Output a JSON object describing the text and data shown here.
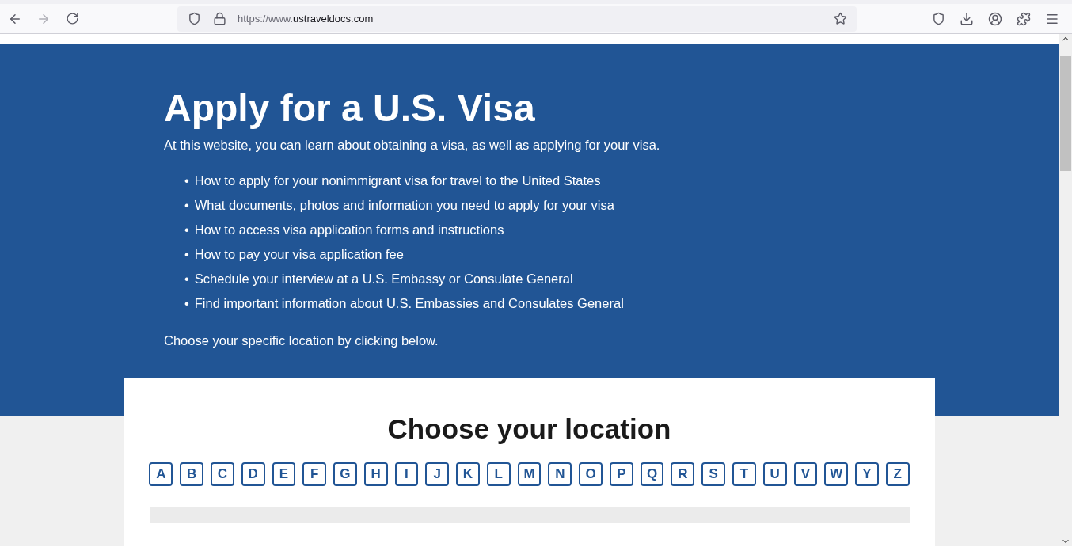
{
  "browser": {
    "url_prefix": "https://www.",
    "url_domain": "ustraveldocs.com"
  },
  "hero": {
    "title": "Apply for a U.S. Visa",
    "intro": "At this website, you can learn about obtaining a visa, as well as applying for your visa.",
    "bullets": [
      {
        "marker": "•",
        "text": "How to apply for your nonimmigrant visa for travel to the United States"
      },
      {
        "marker": "•",
        "text": "What documents, photos and information you need to apply for your visa"
      },
      {
        "marker": "•",
        "text": "How to access visa application forms and instructions"
      },
      {
        "marker": "•",
        "text": "How to pay your visa application fee"
      },
      {
        "marker": "•",
        "text": "Schedule your interview at a U.S. Embassy or Consulate General"
      },
      {
        "marker": "•",
        "text": "Find important information about U.S. Embassies and Consulates General"
      }
    ],
    "outro": "Choose your specific location by clicking below."
  },
  "location": {
    "title": "Choose your location",
    "letters": [
      "A",
      "B",
      "C",
      "D",
      "E",
      "F",
      "G",
      "H",
      "I",
      "J",
      "K",
      "L",
      "M",
      "N",
      "O",
      "P",
      "Q",
      "R",
      "S",
      "T",
      "U",
      "V",
      "W",
      "Y",
      "Z"
    ]
  }
}
